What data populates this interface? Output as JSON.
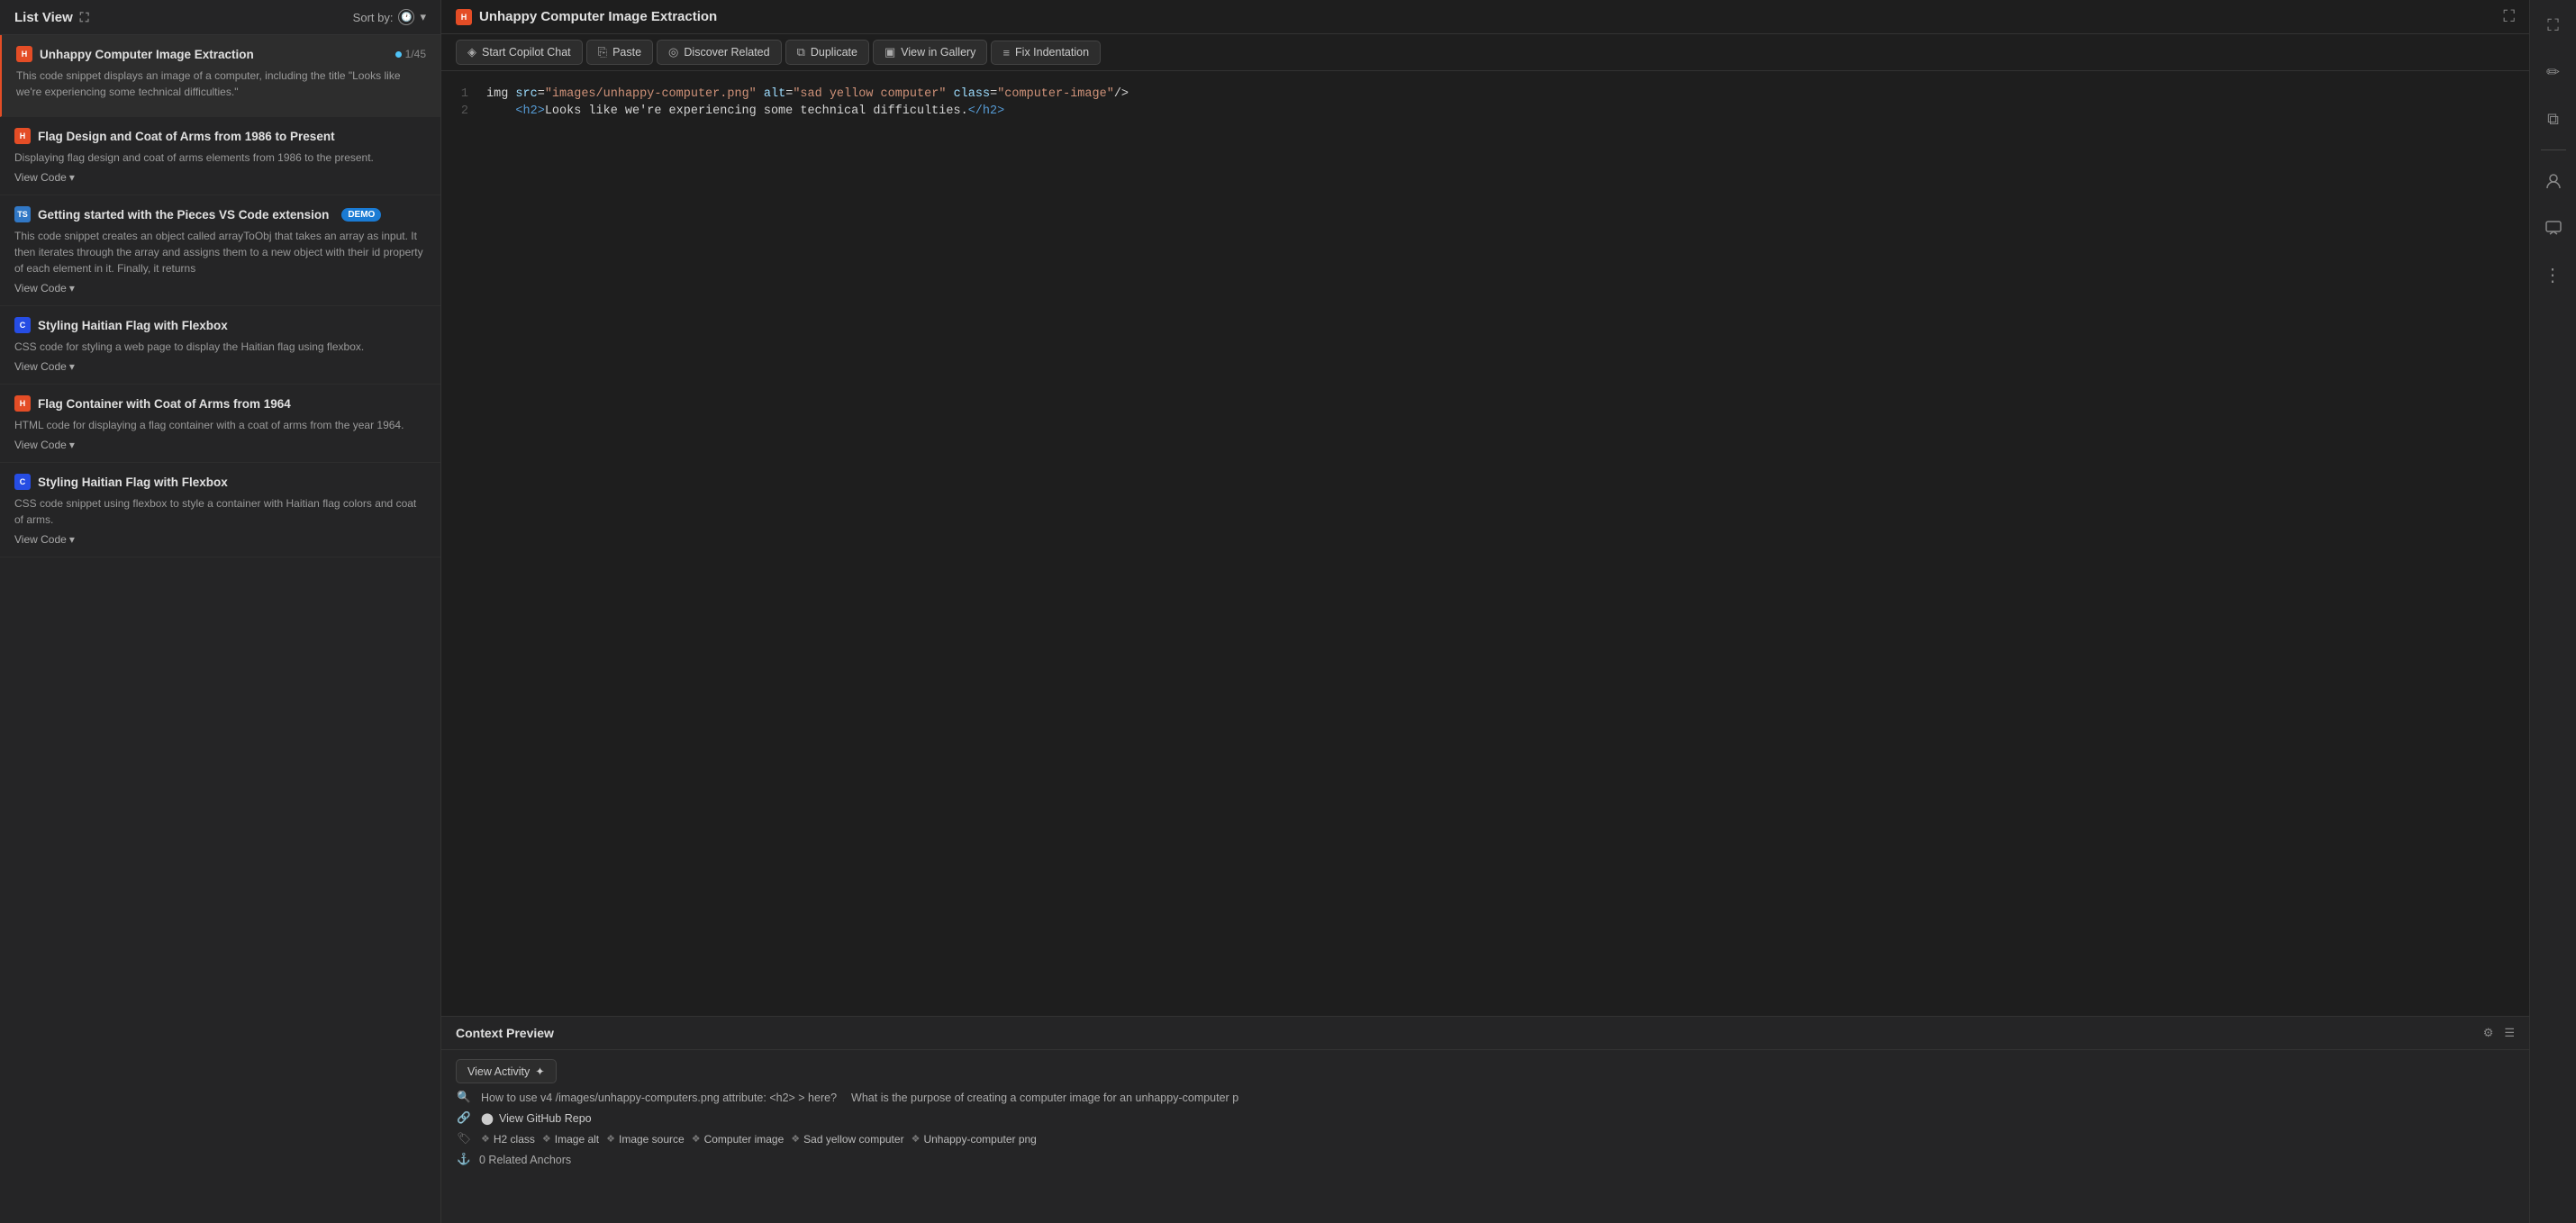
{
  "leftPanel": {
    "title": "List View",
    "sortLabel": "Sort by:",
    "items": [
      {
        "id": 1,
        "lang": "HTML",
        "langClass": "lang-html",
        "title": "Unhappy Computer Image Extraction",
        "count": "1/45",
        "showDot": true,
        "desc": "This code snippet displays an image of a computer, including the title \"Looks like we're experiencing some technical difficulties.\"",
        "viewCode": "View Code",
        "active": true,
        "badge": null
      },
      {
        "id": 2,
        "lang": "HTML",
        "langClass": "lang-html",
        "title": "Flag Design and Coat of Arms from 1986 to Present",
        "count": null,
        "showDot": false,
        "desc": "Displaying flag design and coat of arms elements from 1986 to the present.",
        "viewCode": "View Code",
        "active": false,
        "badge": null
      },
      {
        "id": 3,
        "lang": "TS",
        "langClass": "lang-ts",
        "title": "Getting started with the Pieces VS Code extension",
        "count": null,
        "showDot": false,
        "desc": "This code snippet creates an object called arrayToObj that takes an array as input. It then iterates through the array and assigns them to a new object with their id property of each element in it. Finally, it returns",
        "viewCode": "View Code",
        "active": false,
        "badge": "DEMO"
      },
      {
        "id": 4,
        "lang": "CSS",
        "langClass": "lang-css",
        "title": "Styling Haitian Flag with Flexbox",
        "count": null,
        "showDot": false,
        "desc": "CSS code for styling a web page to display the Haitian flag using flexbox.",
        "viewCode": "View Code",
        "active": false,
        "badge": null
      },
      {
        "id": 5,
        "lang": "HTML",
        "langClass": "lang-html",
        "title": "Flag Container with Coat of Arms from 1964",
        "count": null,
        "showDot": false,
        "desc": "HTML code for displaying a flag container with a coat of arms from the year 1964.",
        "viewCode": "View Code",
        "active": false,
        "badge": null
      },
      {
        "id": 6,
        "lang": "CSS",
        "langClass": "lang-css",
        "title": "Styling Haitian Flag with Flexbox",
        "count": null,
        "showDot": false,
        "desc": "CSS code snippet using flexbox to style a container with Haitian flag colors and coat of arms.",
        "viewCode": "View Code",
        "active": false,
        "badge": null
      }
    ]
  },
  "mainPanel": {
    "title": "Unhappy Computer Image Extraction",
    "toolbar": {
      "startCopilot": "Start Copilot Chat",
      "paste": "Paste",
      "discoverRelated": "Discover Related",
      "duplicate": "Duplicate",
      "viewInGallery": "View in Gallery",
      "fixIndentation": "Fix Indentation"
    },
    "code": {
      "lines": [
        {
          "num": 1,
          "content": "img src=\"images/unhappy-computer.png\" alt=\"sad yellow computer\" class=\"computer-image\"/>"
        },
        {
          "num": 2,
          "content": "    <h2>Looks like we're experiencing some technical difficulties.</h2>"
        }
      ]
    }
  },
  "contextPreview": {
    "title": "Context Preview",
    "viewActivityLabel": "View Activity",
    "questions": [
      "How to use v4 /images/unhappy-computers.png attribute: <h2> > here?",
      "What is the purpose of creating a computer image for an unhappy-computer p"
    ],
    "githubLink": "View GitHub Repo",
    "tags": [
      {
        "label": "H2 class"
      },
      {
        "label": "Image alt"
      },
      {
        "label": "Image source"
      },
      {
        "label": "Computer image"
      },
      {
        "label": "Sad yellow computer"
      },
      {
        "label": "Unhappy-computer png"
      }
    ],
    "anchors": "0 Related Anchors"
  },
  "rightSidebar": {
    "icons": [
      {
        "name": "fullscreen-icon",
        "symbol": "⛶"
      },
      {
        "name": "edit-icon",
        "symbol": "✏"
      },
      {
        "name": "copy-icon",
        "symbol": "⧉"
      },
      {
        "name": "person-icon",
        "symbol": "👤"
      },
      {
        "name": "message-icon",
        "symbol": "💬"
      },
      {
        "name": "more-icon",
        "symbol": "⋮"
      }
    ]
  }
}
